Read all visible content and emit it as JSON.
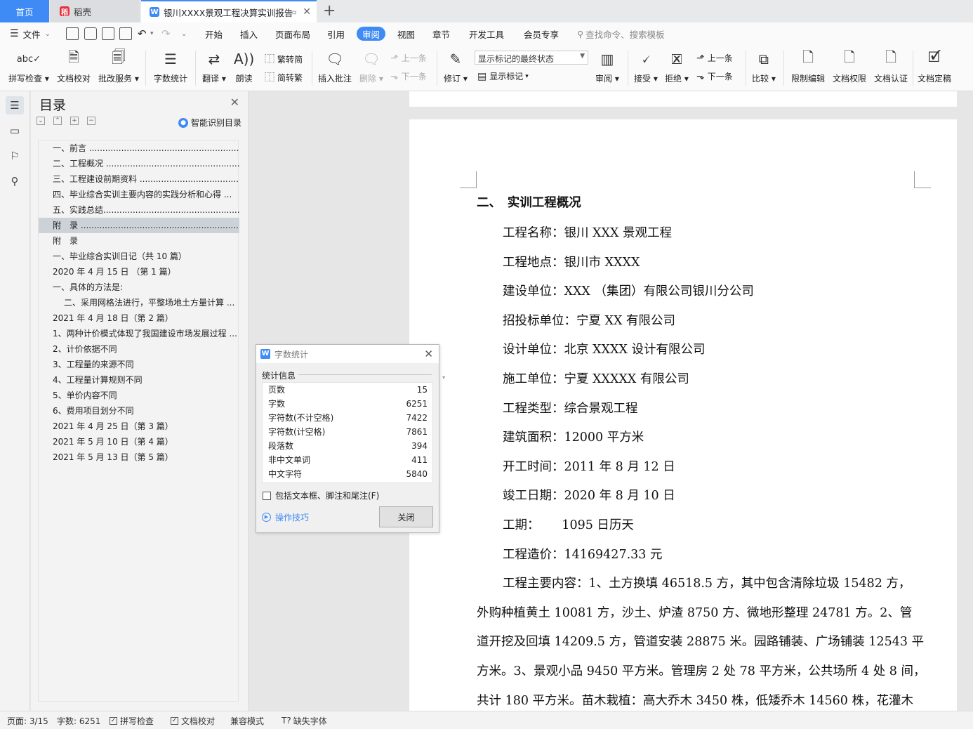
{
  "tabs": {
    "home": "首页",
    "daoke": "稻壳",
    "doc_title": "银川XXXX景观工程决算实训报告",
    "plus": "+"
  },
  "menu": {
    "file": "文件",
    "items": [
      "开始",
      "插入",
      "页面布局",
      "引用",
      "审阅",
      "视图",
      "章节",
      "开发工具",
      "会员专享"
    ],
    "search_placeholder": "查找命令、搜索模板"
  },
  "ribbon": {
    "spell_check": "拼写检查",
    "doc_proof": "文档校对",
    "annotate_service": "批改服务",
    "word_count": "字数统计",
    "translate": "翻译",
    "read_aloud": "朗读",
    "trad_to_simp": "繁转简",
    "simp_to_trad": "简转繁",
    "insert_comment": "插入批注",
    "delete": "删除",
    "prev_comment": "上一条",
    "next_comment": "下一条",
    "revise": "修订",
    "markup_state": "显示标记的最终状态",
    "show_markup": "显示标记",
    "review": "审阅",
    "accept": "接受",
    "reject": "拒绝",
    "prev_change": "上一条",
    "next_change": "下一条",
    "compare": "比较",
    "restrict_edit": "限制编辑",
    "doc_permission": "文档权限",
    "doc_auth": "文档认证",
    "doc_finalize": "文档定稿"
  },
  "toc": {
    "title": "目录",
    "smart_label": "智能识别目录",
    "items": [
      {
        "text": "一、前言 ..............................................................",
        "selected": false,
        "indent": false
      },
      {
        "text": "二、工程概况 ....................................................",
        "selected": false,
        "indent": false
      },
      {
        "text": "三、工程建设前期资料 .........................................",
        "selected": false,
        "indent": false
      },
      {
        "text": "四、毕业综合实训主要内容的实践分析和心得 ...",
        "selected": false,
        "indent": false
      },
      {
        "text": "五、实践总结.......................................................",
        "selected": false,
        "indent": false
      },
      {
        "text": "附　录 .................................................................",
        "selected": true,
        "indent": false
      },
      {
        "text": "附　录",
        "selected": false,
        "indent": false
      },
      {
        "text": "一、毕业综合实训日记（共 10 篇）",
        "selected": false,
        "indent": false
      },
      {
        "text": "2020 年 4 月 15 日 （第 1 篇）",
        "selected": false,
        "indent": false
      },
      {
        "text": "一、具体的方法是:",
        "selected": false,
        "indent": false
      },
      {
        "text": "二、采用网格法进行，平整场地土方量计算 ...",
        "selected": false,
        "indent": true
      },
      {
        "text": "2021 年 4 月 18 日（第 2 篇）",
        "selected": false,
        "indent": false
      },
      {
        "text": "1、两种计价模式体现了我国建设市场发展过程 ...",
        "selected": false,
        "indent": false
      },
      {
        "text": "2、计价依据不同",
        "selected": false,
        "indent": false
      },
      {
        "text": "3、工程量的来源不同",
        "selected": false,
        "indent": false
      },
      {
        "text": "4、工程量计算规则不同",
        "selected": false,
        "indent": false
      },
      {
        "text": "5、单价内容不同",
        "selected": false,
        "indent": false
      },
      {
        "text": "6、费用项目划分不同",
        "selected": false,
        "indent": false
      },
      {
        "text": "2021 年 4 月 25 日（第 3 篇）",
        "selected": false,
        "indent": false
      },
      {
        "text": "2021 年 5 月 10 日（第 4 篇）",
        "selected": false,
        "indent": false
      },
      {
        "text": "2021 年 5 月 13 日（第 5 篇）",
        "selected": false,
        "indent": false
      }
    ]
  },
  "document": {
    "heading": "二、　实训工程概况",
    "lines": [
      {
        "text": "工程名称：银川 XXX 景观工程",
        "indent": true
      },
      {
        "text": "工程地点：银川市 XXXX",
        "indent": true
      },
      {
        "text": "建设单位：XXX （集团）有限公司银川分公司",
        "indent": true
      },
      {
        "text": "招投标单位：宁夏 XX 有限公司",
        "indent": true
      },
      {
        "text": "设计单位：北京 XXXX 设计有限公司",
        "indent": true
      },
      {
        "text": "施工单位：宁夏 XXXXX 有限公司",
        "indent": true
      },
      {
        "text": "工程类型：综合景观工程",
        "indent": true
      },
      {
        "text": "建筑面积：12000 平方米",
        "indent": true
      },
      {
        "text": "开工时间：2011 年 8 月 12 日",
        "indent": true
      },
      {
        "text": "竣工日期：2020 年 8 月 10 日",
        "indent": true
      },
      {
        "text": "工期：　　  1095 日历天",
        "indent": true
      },
      {
        "text": "工程造价：14169427.33 元",
        "indent": true
      },
      {
        "text": "工程主要内容：1、土方换填 46518.5 方，其中包含清除垃圾 15482 方，",
        "indent": true
      },
      {
        "text": "外购种植黄土 10081 方，沙土、炉渣 8750 方、微地形整理 24781 方。2、管",
        "indent": false
      },
      {
        "text": "道开挖及回填 14209.5 方，管道安装 28875 米。园路铺装、广场铺装 12543 平",
        "indent": false
      },
      {
        "text": "方米。3、景观小品 9450 平方米。管理房 2 处 78 平方米，公共场所 4 处 8 间，",
        "indent": false
      },
      {
        "text": "共计 180 平方米。苗木栽植：高大乔木 3450 株，低矮乔木 14560 株，花灌木",
        "indent": false
      }
    ]
  },
  "dialog": {
    "title": "字数统计",
    "section": "统计信息",
    "rows": [
      {
        "label": "页数",
        "value": "15"
      },
      {
        "label": "字数",
        "value": "6251"
      },
      {
        "label": "字符数(不计空格)",
        "value": "7422"
      },
      {
        "label": "字符数(计空格)",
        "value": "7861"
      },
      {
        "label": "段落数",
        "value": "394"
      },
      {
        "label": "非中文单词",
        "value": "411"
      },
      {
        "label": "中文字符",
        "value": "5840"
      }
    ],
    "checkbox_label": "包括文本框、脚注和尾注(F)",
    "tips_label": "操作技巧",
    "close_label": "关闭"
  },
  "status": {
    "page": "页面: 3/15",
    "words": "字数: 6251",
    "spell_check": "拼写检查",
    "doc_proof": "文档校对",
    "compat_mode": "兼容模式",
    "missing_font": "缺失字体"
  },
  "colors": {
    "accent": "#3e8bf5",
    "selection": "#cdd2d9"
  }
}
